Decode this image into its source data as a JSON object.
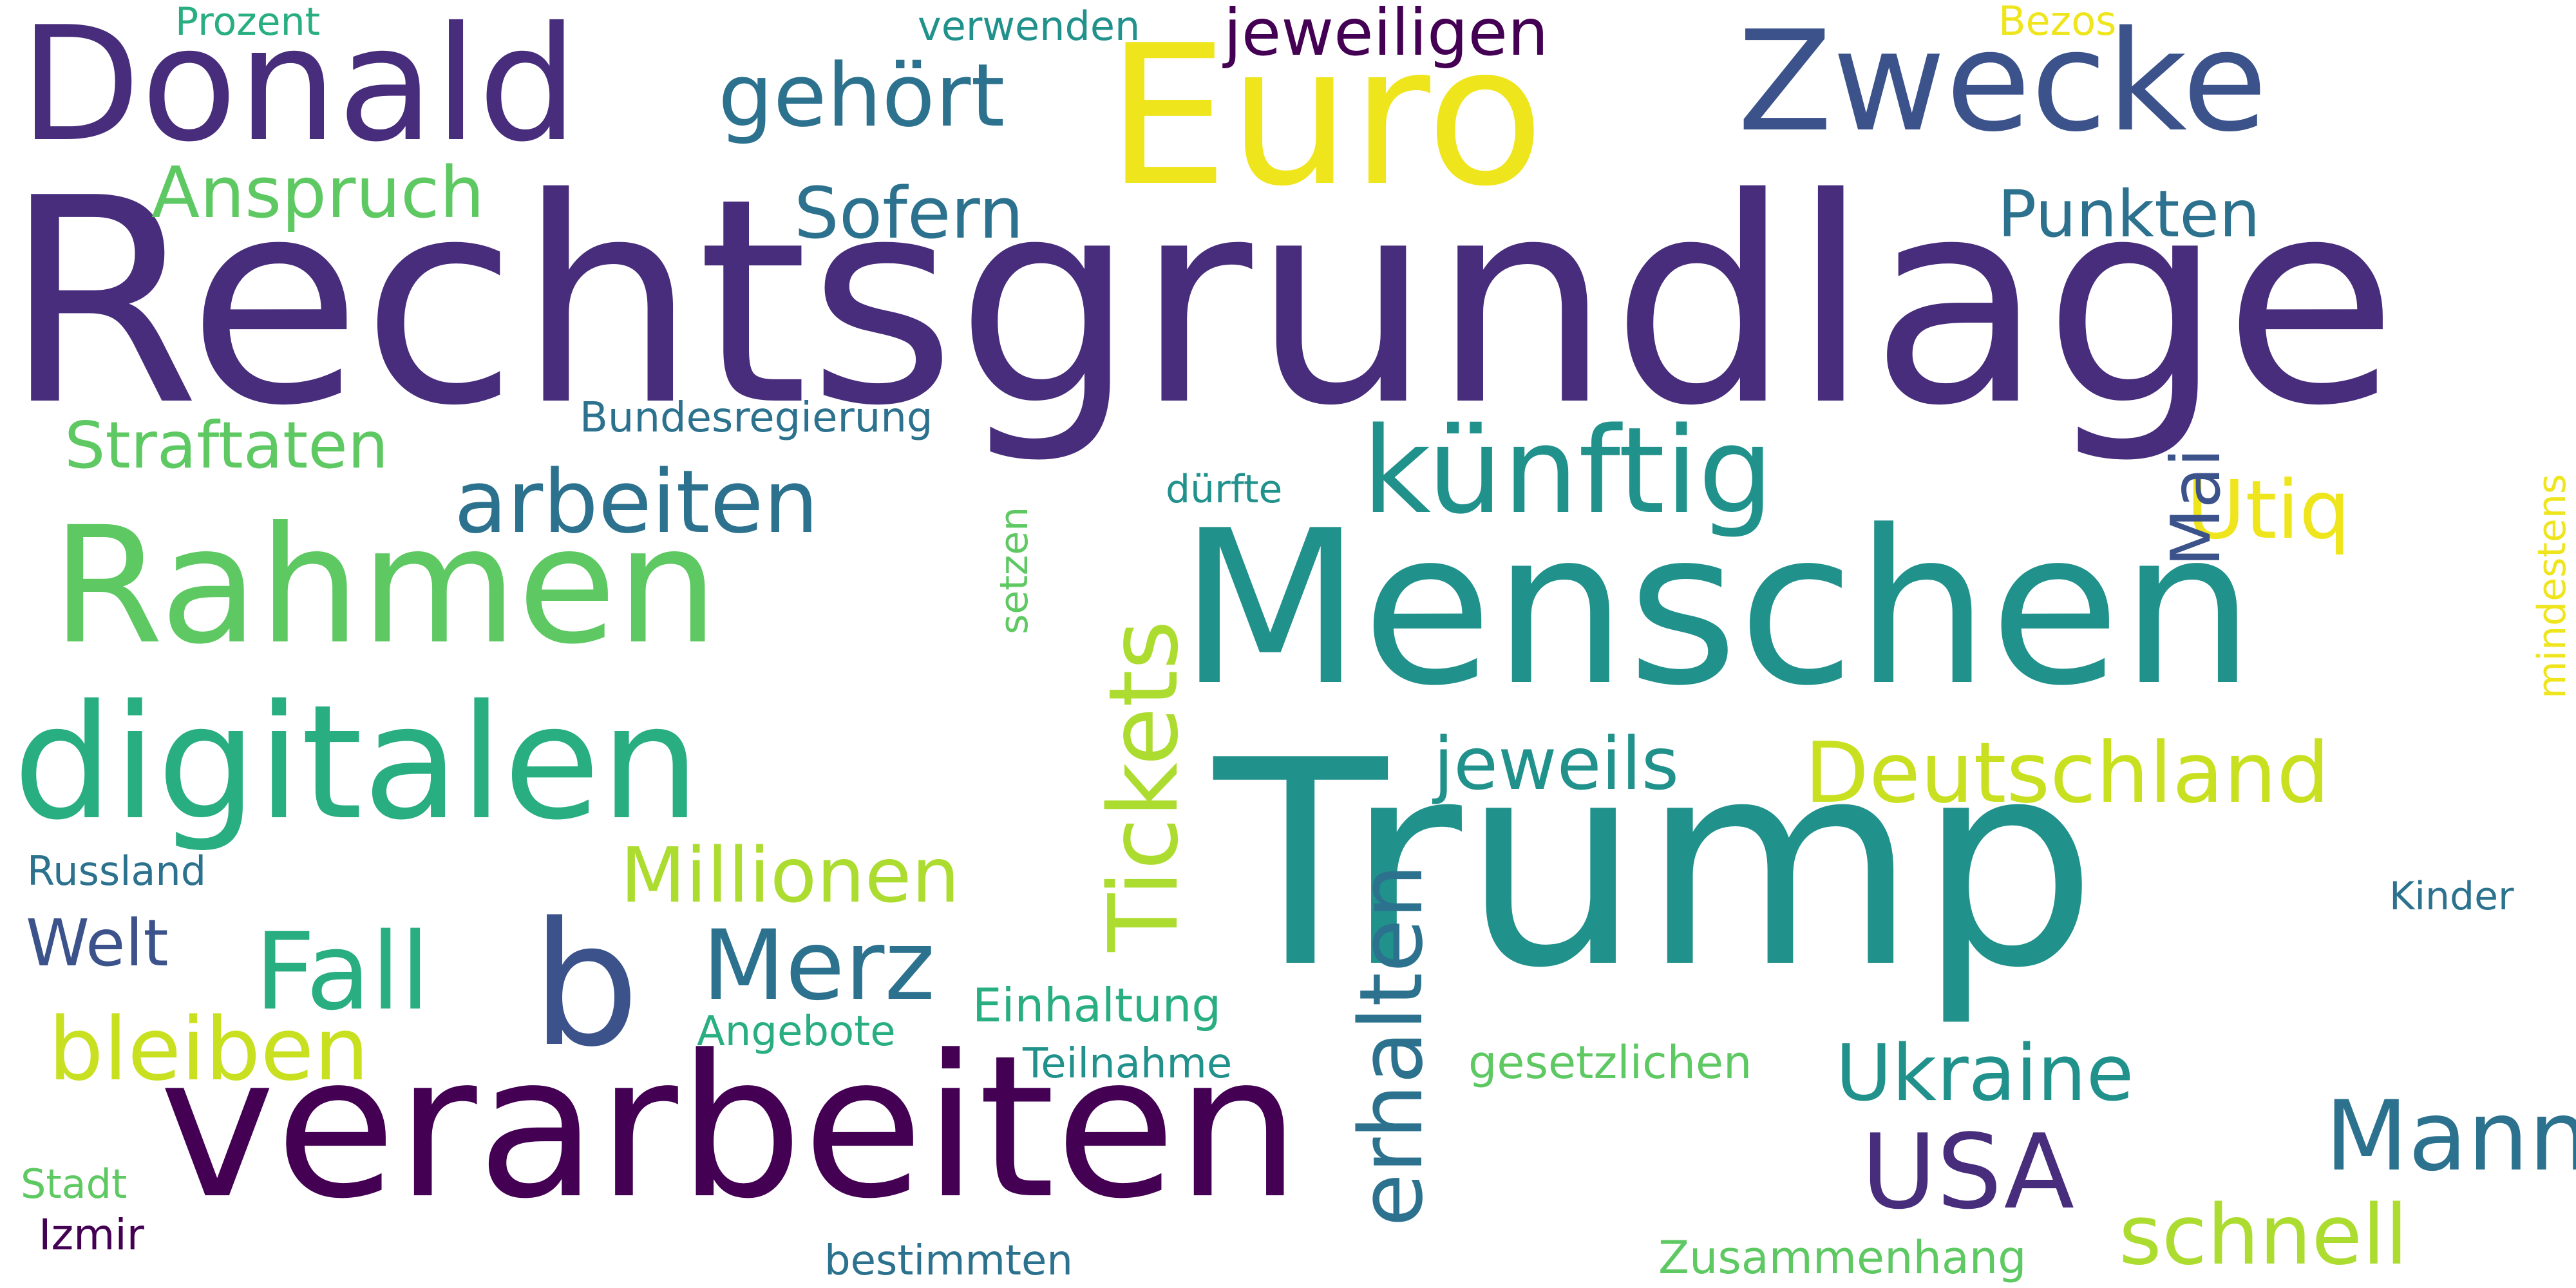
{
  "words": {
    "rechtsgrundlage": "Rechtsgrundlage",
    "verarbeiten": "verarbeiten",
    "menschen": "Menschen",
    "trump": "Trump",
    "euro": "Euro",
    "donald": "Donald",
    "zwecke": "Zwecke",
    "rahmen": "Rahmen",
    "digitalen": "digitalen",
    "kuenftig": "künftig",
    "b": "b",
    "deutschland": "Deutschland",
    "jeweiligen": "jeweiligen",
    "gehoert": "gehört",
    "arbeiten": "arbeiten",
    "straftaten": "Straftaten",
    "anspruch": "Anspruch",
    "sofern": "Sofern",
    "punkten": "Punkten",
    "millionen": "Millionen",
    "jeweils": "jeweils",
    "merz": "Merz",
    "fall": "Fall",
    "bleiben": "bleiben",
    "welt": "Welt",
    "ukraine": "Ukraine",
    "usa": "USA",
    "mann": "Mann",
    "schnell": "schnell",
    "utiq": "Utiq",
    "kinder": "Kinder",
    "bundesregierung": "Bundesregierung",
    "duerfte": "dürfte",
    "russland": "Russland",
    "einhaltung": "Einhaltung",
    "angebote": "Angebote",
    "teilnahme": "Teilnahme",
    "gesetzlichen": "gesetzlichen",
    "stadt": "Stadt",
    "izmir": "Izmir",
    "bestimmten": "bestimmten",
    "zusammenhang": "Zusammenhang",
    "prozent": "Prozent",
    "verwenden": "verwenden",
    "bezos": "Bezos",
    "tickets": "Tickets",
    "erhalten": "erhalten",
    "mai": "Mai",
    "setzen": "setzen",
    "mindestens": "mindestens"
  },
  "colors": {
    "dark_purple": "#440154",
    "indigo": "#472d7b",
    "blue": "#3b528b",
    "slate": "#2c728e",
    "teal": "#21918c",
    "teal_green": "#28ae80",
    "green": "#5ec962",
    "light_green": "#addc30",
    "yellow_green": "#c8e020",
    "yellow": "#efe51c",
    "background": "#ffffff"
  }
}
